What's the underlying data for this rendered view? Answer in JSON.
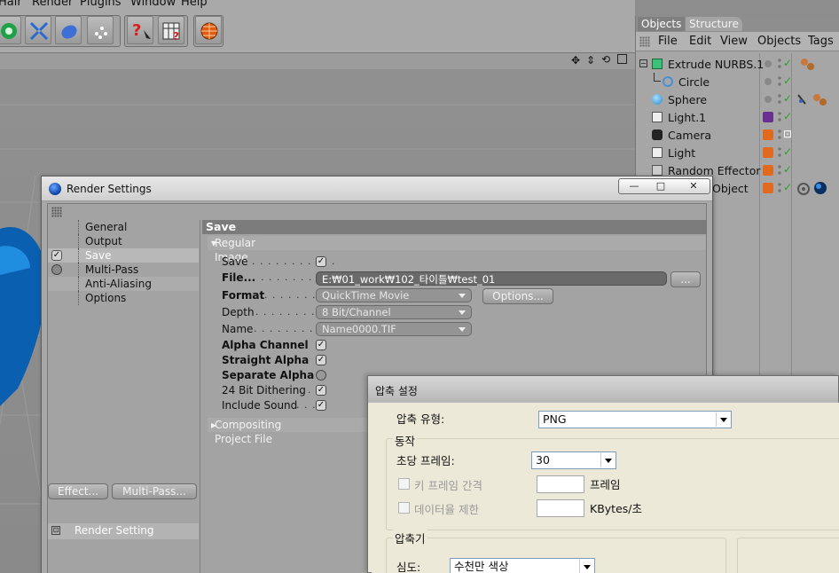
{
  "menubar": {
    "items": [
      "Hair",
      "Render",
      "Plugins",
      "Window",
      "Help"
    ]
  },
  "object_manager": {
    "tabs": [
      "Objects",
      "Structure"
    ],
    "menu": [
      "File",
      "Edit",
      "View",
      "Objects",
      "Tags"
    ],
    "rows": [
      {
        "name": "Extrude NURBS.1",
        "color": "#8a8a8a"
      },
      {
        "name": "Circle",
        "color": "#8a8a8a"
      },
      {
        "name": "Sphere",
        "color": "#8a8a8a"
      },
      {
        "name": "Light.1",
        "color": "#6a3090"
      },
      {
        "name": "Camera",
        "color": "#e06a1e"
      },
      {
        "name": "Light",
        "color": "#e06a1e"
      },
      {
        "name": "Random Effector",
        "color": "#e06a1e"
      },
      {
        "name": "Object",
        "color": "#e06a1e"
      }
    ]
  },
  "render_settings": {
    "title": "Render Settings",
    "window_buttons": {
      "minimize": "—",
      "maximize": "□",
      "close": "✕"
    },
    "nav": [
      "General",
      "Output",
      "Save",
      "Multi-Pass",
      "Anti-Aliasing",
      "Options"
    ],
    "buttons": {
      "effect": "Effect...",
      "multipass": "Multi-Pass..."
    },
    "setting_item": "Render Setting",
    "save": {
      "header": "Save",
      "regular_image": "Regular Image",
      "save_label": "Save",
      "file_label": "File...",
      "file_value": "E:₩01_work₩102_타이틀₩test_01",
      "browse_label": "...",
      "format_label": "Format",
      "format_value": "QuickTime Movie",
      "options_label": "Options...",
      "depth_label": "Depth",
      "depth_value": "8 Bit/Channel",
      "name_label": "Name",
      "name_value": "Name0000.TIF",
      "alpha_channel": "Alpha Channel",
      "straight_alpha": "Straight Alpha",
      "separate_alpha": "Separate Alpha",
      "dithering": "24 Bit Dithering",
      "include_sound": "Include Sound",
      "compositing": "Compositing Project File"
    }
  },
  "compression": {
    "title": "압축 설정",
    "type_label": "압축 유형:",
    "type_value": "PNG",
    "motion_group": "동작",
    "fps_label": "초당 프레임:",
    "fps_value": "30",
    "keyframe_label": "키 프레임 간격",
    "keyframe_unit": "프레임",
    "datarate_label": "데이터율 제한",
    "datarate_unit": "KBytes/초",
    "compressor_group": "압축기",
    "depth_label": "심도:",
    "depth_value": "수천만 색상"
  },
  "colors": {
    "accent_blue": "#0a5fb0",
    "orange_tag": "#e06a1e",
    "purple_tag": "#6a3090"
  }
}
